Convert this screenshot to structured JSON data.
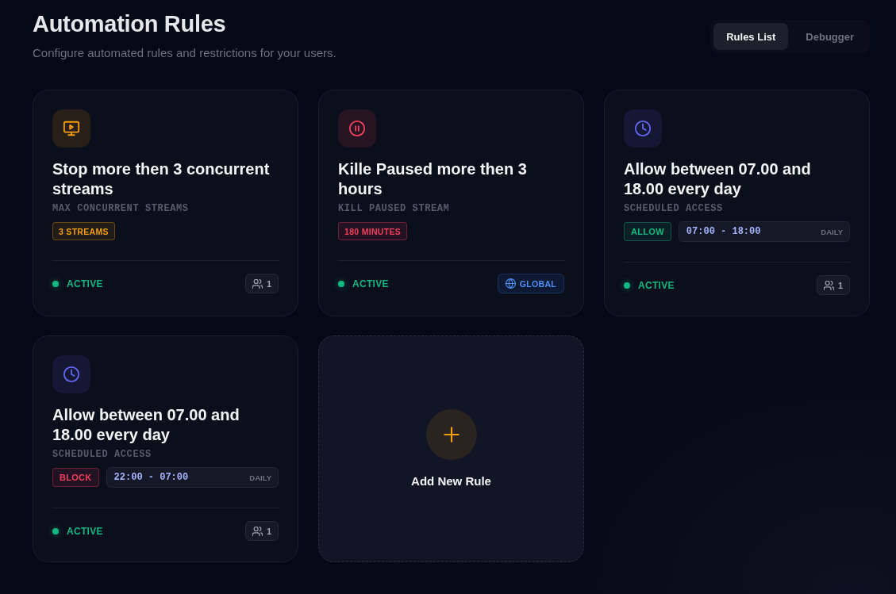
{
  "header": {
    "title": "Automation Rules",
    "subtitle": "Configure automated rules and restrictions for your users."
  },
  "tabs": [
    {
      "label": "Rules List",
      "selected": true
    },
    {
      "label": "Debugger",
      "selected": false
    }
  ],
  "rules": [
    {
      "kind": "max_streams",
      "color": "#f59e0b",
      "title": "Stop more then 3 concurrent streams",
      "type": "MAX CONCURRENT STREAMS",
      "limit": "3 STREAMS",
      "status": {
        "text": "ACTIVE",
        "active": true
      },
      "scope": {
        "kind": "users",
        "text": "1"
      }
    },
    {
      "kind": "kill_paused",
      "color": "#f43f5e",
      "title": "Kille Paused more then 3 hours",
      "type": "KILL PAUSED STREAM",
      "limit": "180 MINUTES",
      "status": {
        "text": "ACTIVE",
        "active": true
      },
      "scope": {
        "kind": "global",
        "text": "GLOBAL"
      }
    },
    {
      "kind": "scheduled_access",
      "color": "#6366f1",
      "title": "Allow between 07.00 and 18.00 every day",
      "type": "SCHEDULED ACCESS",
      "action": {
        "text": "ALLOW",
        "color": "#10b981"
      },
      "schedule": {
        "time": "07:00 - 18:00",
        "repeat": "DAILY"
      },
      "status": {
        "text": "ACTIVE",
        "active": true
      },
      "scope": {
        "kind": "users",
        "text": "1"
      }
    },
    {
      "kind": "scheduled_access",
      "color": "#6366f1",
      "title": "Allow between 07.00 and 18.00 every day",
      "type": "SCHEDULED ACCESS",
      "action": {
        "text": "BLOCK",
        "color": "#f43f5e"
      },
      "schedule": {
        "time": "22:00 - 07:00",
        "repeat": "DAILY"
      },
      "status": {
        "text": "ACTIVE",
        "active": true
      },
      "scope": {
        "kind": "users",
        "text": "1"
      }
    }
  ],
  "add_card": {
    "label": "Add New Rule"
  }
}
